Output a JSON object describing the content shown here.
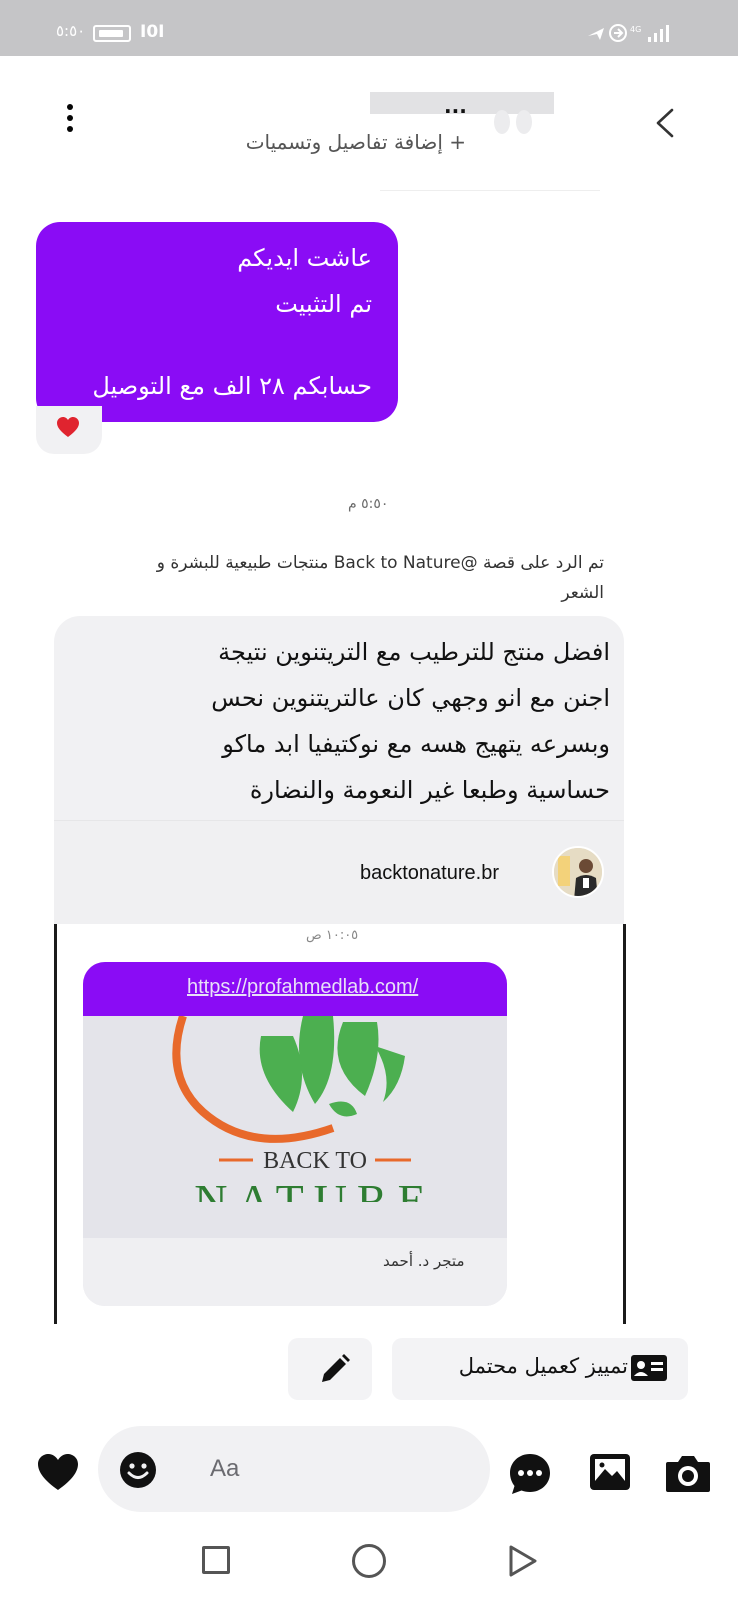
{
  "status_bar": {
    "time": "٥:٥٠",
    "sim": "I0I",
    "signal": "⁴ᴳ"
  },
  "header": {
    "title_masked": "...",
    "add_details": "+ إضافة تفاصيل وتسميات"
  },
  "sent_message": {
    "lines": [
      "عاشت ايديكم",
      "تم التثبيت",
      "",
      "حسابكم ٢٨ الف مع التوصيل"
    ],
    "reaction": "heart"
  },
  "timestamp_1": "٥:٥٠ م",
  "reply_label": "تم الرد على قصة @Back to Nature  منتجات طبيعية للبشرة و الشعر",
  "received_message": {
    "lines": [
      "افضل منتج للترطيب مع التريتنوين نتيجة",
      "اجنن مع انو وجهي كان عالتريتنوين نحس",
      "وبسرعه يتهيج هسه مع نوكتيفيا ابد ماكو",
      "حساسية وطبعا غير النعومة والنضارة"
    ]
  },
  "story": {
    "account": "backtonature.br",
    "timestamp": "١٠:٠٥ ص",
    "link_url": "https://profahmedlab.com/",
    "logo_line1": "BACK TO",
    "logo_line2": "NATURE",
    "shop_name": "متجر د. أحمد"
  },
  "actions": {
    "mark_customer": "تمييز كعميل محتمل"
  },
  "composer": {
    "placeholder": "Aa"
  },
  "colors": {
    "accent": "#8a0cf5",
    "bubble_gray": "#f1f1f3"
  }
}
